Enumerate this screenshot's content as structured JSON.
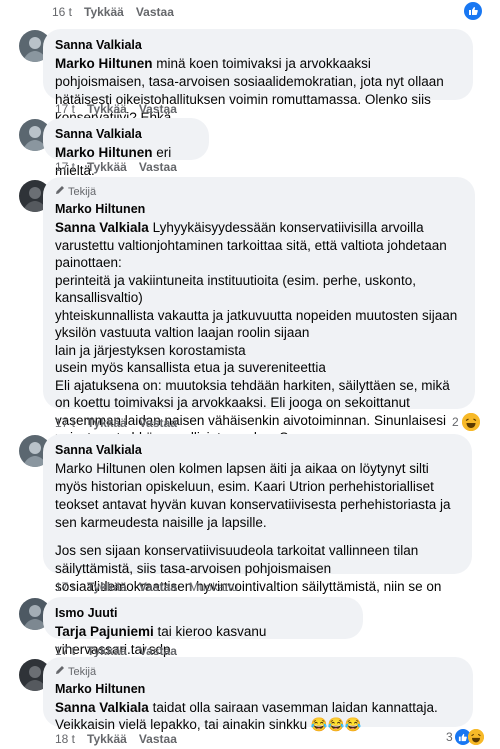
{
  "top": {
    "time": "16 t",
    "like": "Tykkää",
    "reply": "Vastaa"
  },
  "comments": [
    {
      "author": "Sanna Valkiala",
      "mention": "Marko Hiltunen",
      "text": " minä koen toimivaksi ja arvokkaaksi pohjoismaisen, tasa-arvoisen sosiaalidemokratian, jota nyt ollaan hätäisesti oikeistohallituksen voimin romuttamassa. Olenko siis konservatiivi? Ehkä.",
      "time": "17 t",
      "like": "Tykkää",
      "reply": "Vastaa"
    },
    {
      "author": "Sanna Valkiala",
      "mention": "Marko Hiltunen",
      "text": " eri mieltä.",
      "time": "17 t",
      "like": "Tykkää",
      "reply": "Vastaa"
    },
    {
      "badge": "Tekijä",
      "author": "Marko Hiltunen",
      "mention": "Sanna Valkiala",
      "lines": [
        " Lyhyykäisyydessään konservatiivisilla arvoilla varustettu valtionjohtaminen tarkoittaa sitä, että valtiota johdetaan painottaen:",
        "perinteitä ja vakiintuneita instituutioita (esim. perhe, uskonto, kansallisvaltio)",
        "yhteiskunnallista vakautta ja jatkuvuutta nopeiden muutosten sijaan",
        "yksilön vastuuta valtion laajan roolin sijaan",
        "lain ja järjestyksen korostamista",
        "usein myös kansallista etua ja suvereniteettia",
        "Eli ajatuksena on: muutoksia tehdään harkiten, säilyttäen se, mikä on koettu toimivaksi ja arvokkaaksi. Eli jooga on sekoittanut vasemman laidan naisen vähäisenkin aivotoiminnan. Sinunlaisesi naiset ovat ehkä vaarallisinta paskaa Suomen yhteiskuntajärjestykselle!😂😂😂"
      ],
      "reaction_count": "2",
      "time": "17 t",
      "like": "Tykkää",
      "reply": "Vastaa"
    },
    {
      "author": "Sanna Valkiala",
      "paragraphs": [
        "Marko Hiltunen olen kolmen lapsen äiti ja aikaa on löytynyt silti myös historian opiskeluun, esim. Kaari Utrion perhehistorialliset teokset antavat hyvän kuvan konservatiivisesta perhehistoriasta ja sen karmeudesta naisille ja lapsille.",
        "Jos sen sijaan konservatiivisuudeola tarkoitat vallinneen tilan säilyttämistä, siis tasa-arvoisen pohjoismaisen sosiaalidemokraattisen hyvinvointivaltion säilyttämistä, niin se on ok."
      ],
      "time": "17 t",
      "like": "Tykkää",
      "reply": "Vastaa",
      "edited": "Muokattu"
    },
    {
      "author": "Ismo Juuti",
      "mention": "Tarja Pajuniemi",
      "text": " tai kieroo kasvanu vihervassari.tai sdp",
      "time": "17 t",
      "like": "Tykkää",
      "reply": "Vastaa"
    },
    {
      "badge": "Tekijä",
      "author": "Marko Hiltunen",
      "mention": "Sanna Valkiala",
      "text": " taidat olla sairaan vasemman laidan kannattaja. Veikkaisin vielä lepakko, tai ainakin sinkku 😂😂😂",
      "reaction_count": "3",
      "time": "18 t",
      "like": "Tykkää",
      "reply": "Vastaa"
    }
  ],
  "icons": {
    "like": "thumbs-up-icon",
    "laugh": "laugh-emoji-icon",
    "pencil": "pencil-icon"
  },
  "colors": {
    "bubble": "#f0f2f5",
    "like_blue": "#1877f2",
    "meta": "#65676b"
  }
}
